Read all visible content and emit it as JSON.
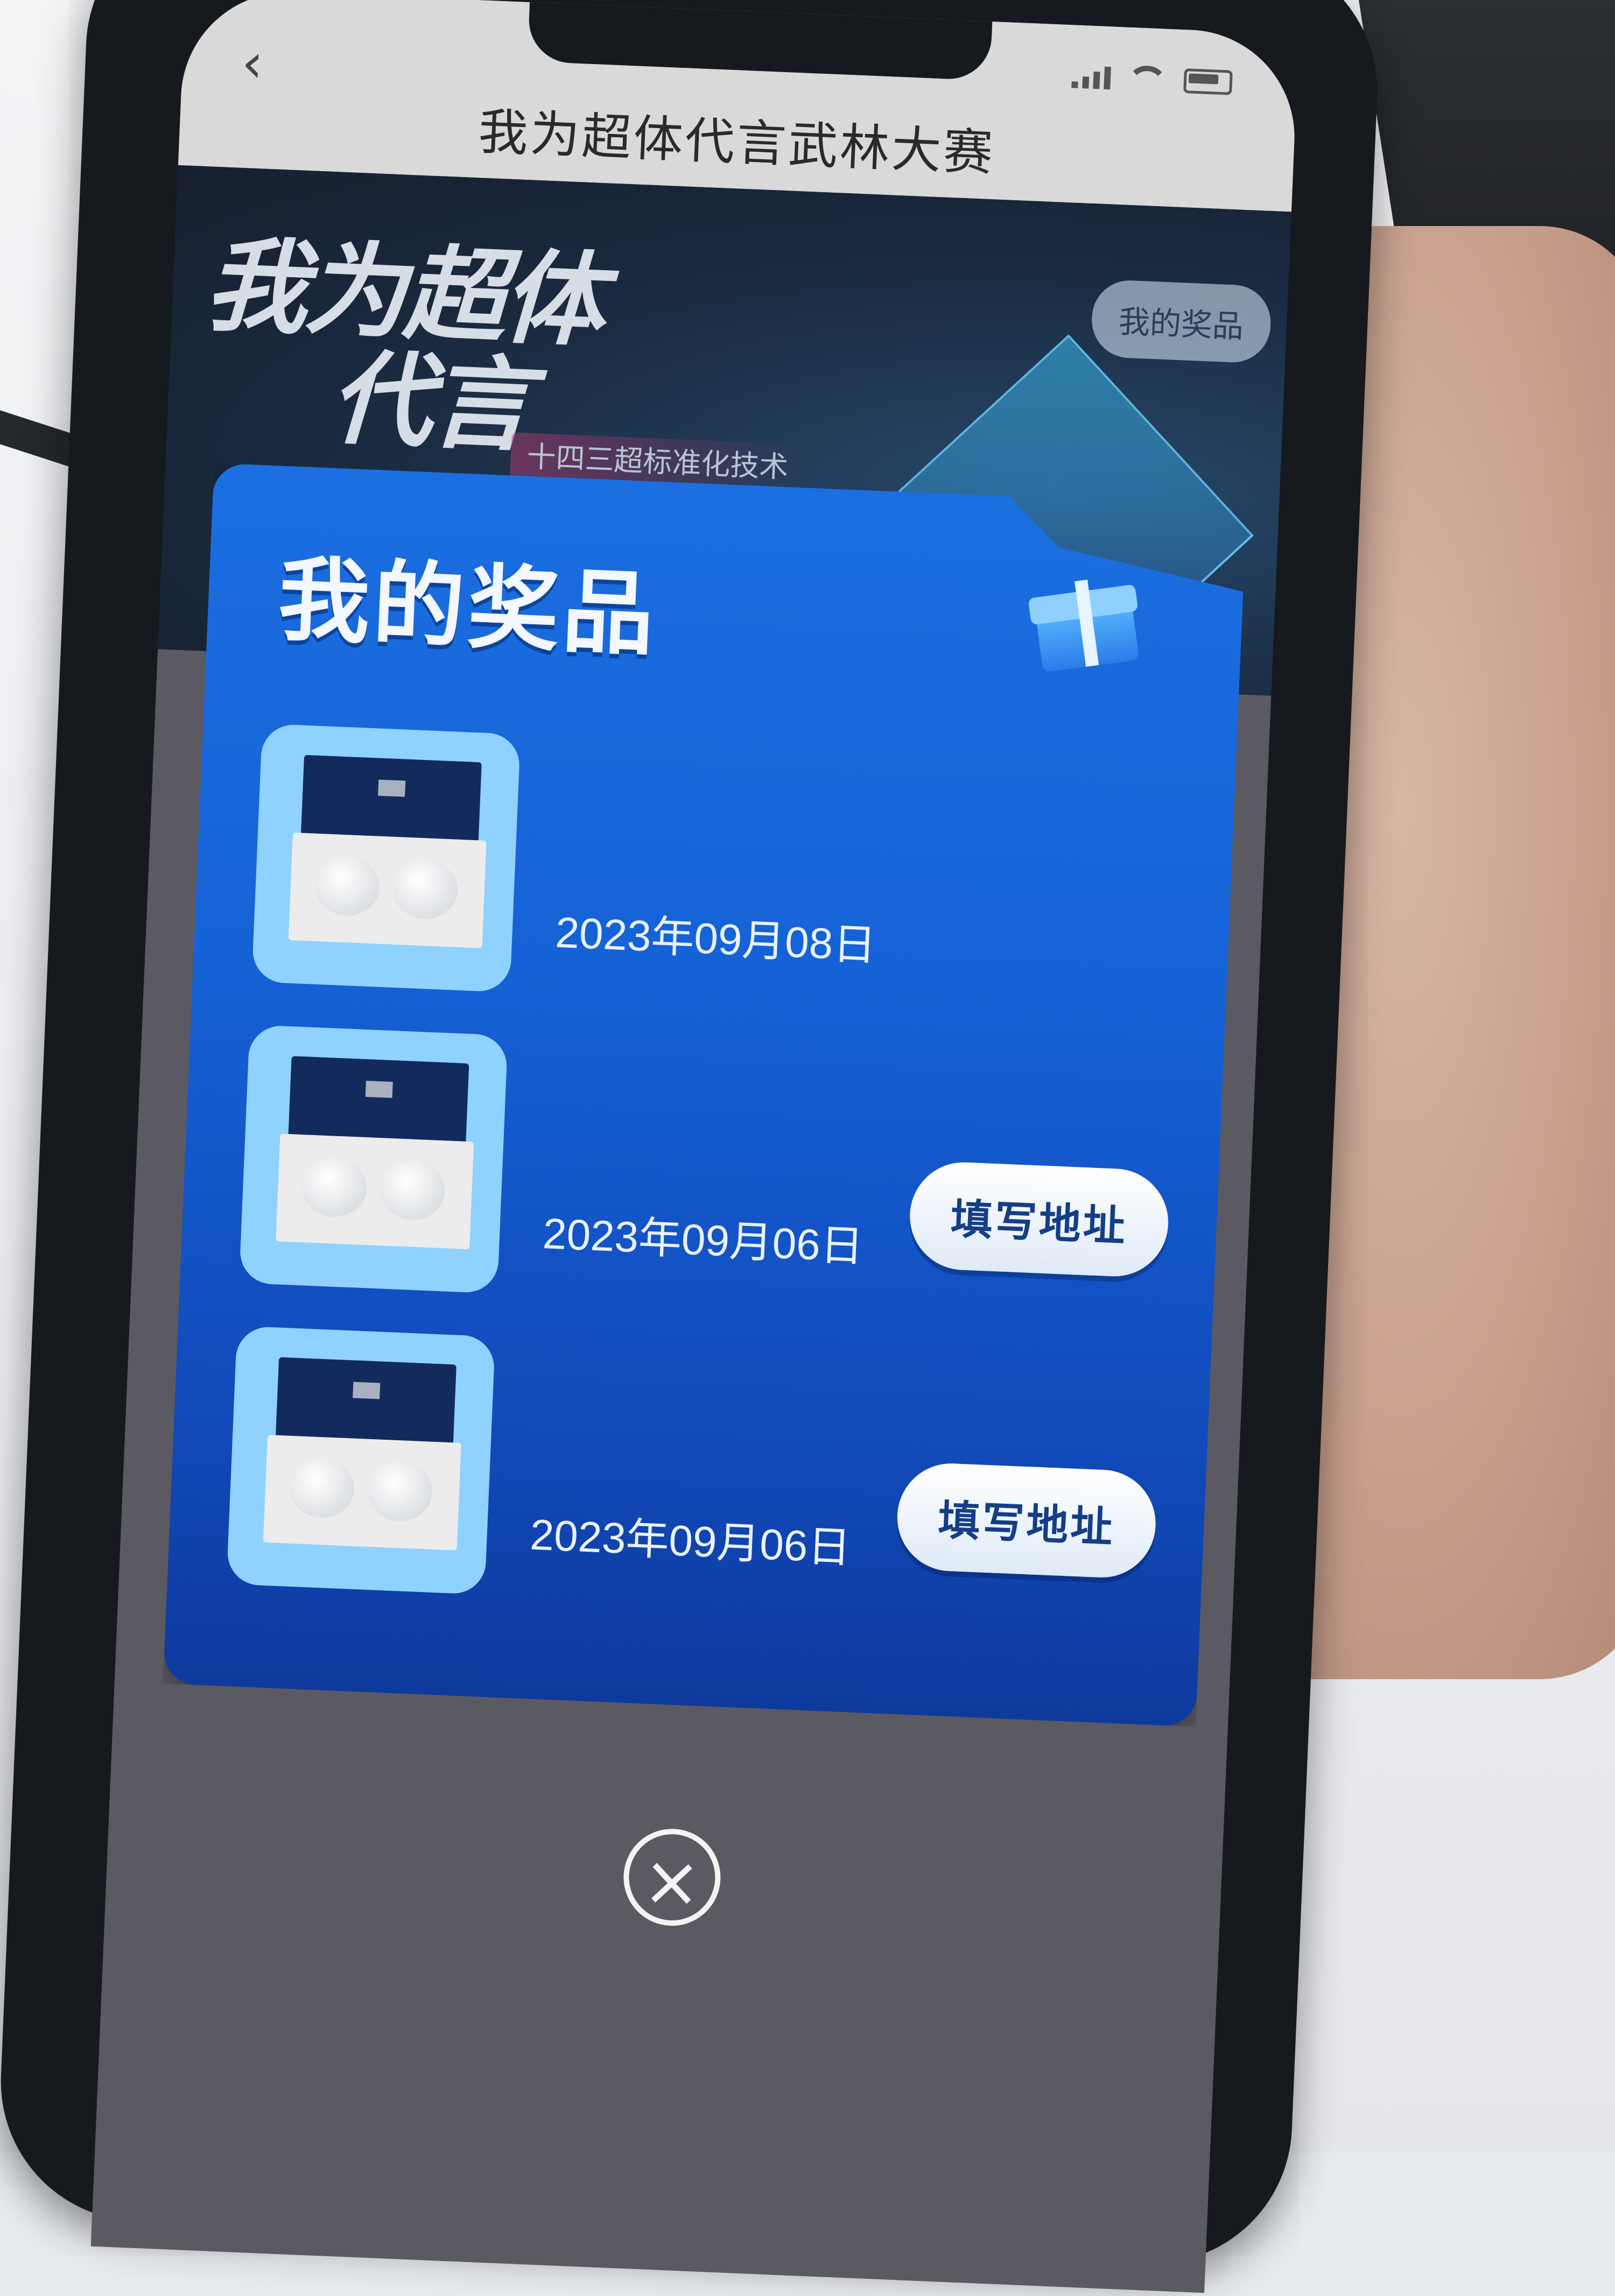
{
  "app": {
    "nav_title": "我为超体代言武林大赛",
    "back_glyph": "‹"
  },
  "banner": {
    "title_line1": "我为超体",
    "title_line2": "代言",
    "subtitle": "十四三超标准化技术\n武林大赛",
    "my_prizes_pill": "我的奖品"
  },
  "modal": {
    "title": "我的奖品",
    "prizes": [
      {
        "date": "2023年09月08日",
        "action_label": ""
      },
      {
        "date": "2023年09月06日",
        "action_label": "填写地址"
      },
      {
        "date": "2023年09月06日",
        "action_label": "填写地址"
      }
    ],
    "close_glyph": "×"
  },
  "icons": [
    "back-icon",
    "signal-icon",
    "wifi-icon",
    "battery-icon",
    "gift-icon",
    "close-icon"
  ],
  "colors": {
    "modal_blue": "#1562d6",
    "button_text": "#143e86",
    "thumb_bg": "#8fd2ff"
  }
}
